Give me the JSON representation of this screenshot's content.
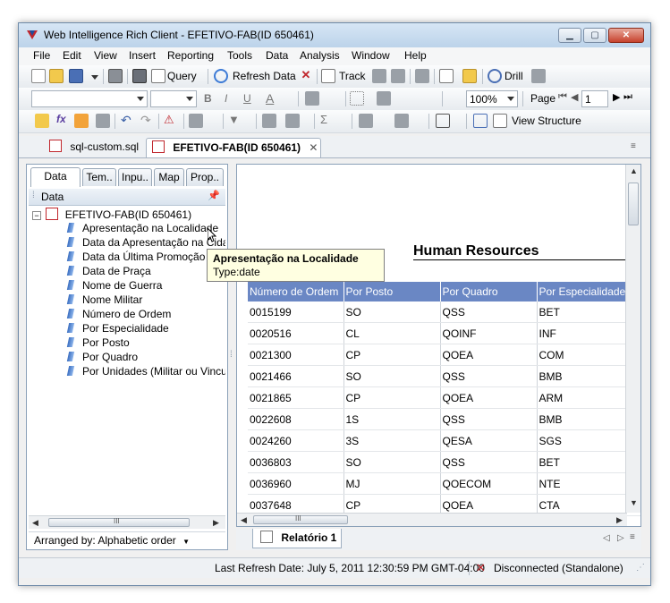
{
  "window": {
    "title": "Web Intelligence Rich Client - EFETIVO-FAB(ID 650461)",
    "controls": [
      "minimize",
      "maximize",
      "close"
    ]
  },
  "menubar": [
    "File",
    "Edit",
    "View",
    "Insert",
    "Reporting",
    "Tools",
    "Data",
    "Analysis",
    "Window",
    "Help"
  ],
  "toolbar1": {
    "query_label": "Query",
    "refresh_label": "Refresh Data",
    "track_label": "Track",
    "drill_label": "Drill"
  },
  "toolbar2": {
    "bold": "B",
    "italic": "I",
    "underline": "U",
    "font_color": "A",
    "zoom": "100%",
    "page_label": "Page",
    "page_number": "1"
  },
  "toolbar3": {
    "view_structure_label": "View Structure"
  },
  "doc_tabs": [
    {
      "label": "sql-custom.sql",
      "active": false
    },
    {
      "label": "EFETIVO-FAB(ID 650461)",
      "active": true
    }
  ],
  "left_panel": {
    "tabs": [
      "Data",
      "Tem..",
      "Inpu..",
      "Map",
      "Prop.."
    ],
    "header": "Data",
    "root": "EFETIVO-FAB(ID 650461)",
    "items": [
      "Apresentação na Localidade",
      "Data da Apresentação na Cidade",
      "Data da Última Promoção",
      "Data de Praça",
      "Nome de Guerra",
      "Nome  Militar",
      "Número de Ordem",
      "Por Especialidade",
      "Por Posto",
      "Por Quadro",
      "Por Unidades (Militar ou Vinculado)"
    ],
    "scroll_grip": "III",
    "arranged_by": "Arranged by: Alphabetic order"
  },
  "tooltip": {
    "title": "Apresentação na Localidade",
    "type": "Type:date"
  },
  "report": {
    "title": "Human Resources",
    "columns": [
      "Número de Ordem",
      "Por Posto",
      "Por Quadro",
      "Por Especialidade"
    ],
    "rows": [
      [
        "0015199",
        "SO",
        "QSS",
        "BET"
      ],
      [
        "0020516",
        "CL",
        "QOINF",
        "INF"
      ],
      [
        "0021300",
        "CP",
        "QOEA",
        "COM"
      ],
      [
        "0021466",
        "SO",
        "QSS",
        "BMB"
      ],
      [
        "0021865",
        "CP",
        "QOEA",
        "ARM"
      ],
      [
        "0022608",
        "1S",
        "QSS",
        "BMB"
      ],
      [
        "0024260",
        "3S",
        "QESA",
        "SGS"
      ],
      [
        "0036803",
        "SO",
        "QSS",
        "BET"
      ],
      [
        "0036960",
        "MJ",
        "QOECOM",
        "NTE"
      ],
      [
        "0037648",
        "CP",
        "QOEA",
        "CTA"
      ]
    ],
    "report_tab": "Relatório 1"
  },
  "status": {
    "last_refresh": "Last Refresh Date: July 5, 2011 12:30:59 PM GMT-04:00",
    "connection": "Disconnected (Standalone)"
  }
}
